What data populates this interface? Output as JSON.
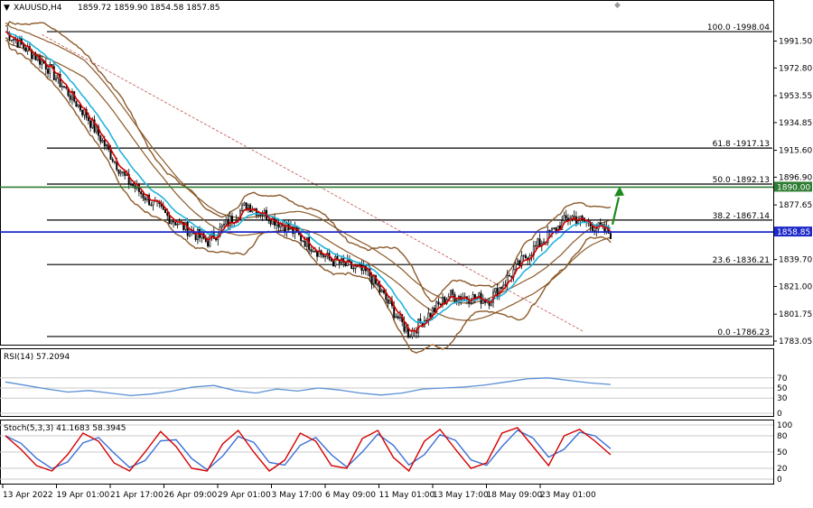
{
  "header": {
    "title": "XAUUSD,H4",
    "ohlc": "1859.72 1859.90 1854.58 1857.85"
  },
  "colors": {
    "candle": "#000000",
    "ema_fast": "#d40000",
    "ema_slow": "#22b3dd",
    "bands": "#8b5a2b",
    "fib": "#000000",
    "resistance": "#2e7d32",
    "price_line": "#1e2ac8",
    "trendline": "#c0504d",
    "arrow": "#1e8a1e",
    "rsi_line": "#5b8fd6",
    "stoch_main": "#d40000",
    "stoch_signal": "#3a6fd6"
  },
  "chart_data": [
    {
      "type": "candlestick",
      "symbol": "XAUUSD",
      "timeframe": "H4",
      "ylim": [
        1783.05,
        2010
      ],
      "y_ticks": [
        "1991.50",
        "1972.80",
        "1953.55",
        "1934.85",
        "1915.60",
        "1896.90",
        "1877.65",
        "1858.95",
        "1839.70",
        "1821.00",
        "1801.75",
        "1783.05"
      ],
      "x_ticks": [
        "13 Apr 2022",
        "19 Apr 01:00",
        "21 Apr 17:00",
        "26 Apr 09:00",
        "29 Apr 01:00",
        "3 May 17:00",
        "6 May 09:00",
        "11 May 01:00",
        "13 May 17:00",
        "18 May 09:00",
        "23 May 01:00"
      ],
      "key_prices": [
        1998,
        1975,
        1940,
        1895,
        1870,
        1852,
        1878,
        1862,
        1840,
        1830,
        1788,
        1815,
        1812,
        1845,
        1870,
        1857.85
      ],
      "fib_levels": [
        {
          "label": "100.0 -1998.04",
          "value": 1998.04
        },
        {
          "label": "61.8 -1917.13",
          "value": 1917.13
        },
        {
          "label": "50.0 -1892.13",
          "value": 1892.13
        },
        {
          "label": "38.2 -1867.14",
          "value": 1867.14
        },
        {
          "label": "23.6 -1836.21",
          "value": 1836.21
        },
        {
          "label": "0.0 -1786.23",
          "value": 1786.23
        }
      ],
      "resistance_label": "1890.00",
      "resistance_value": 1890.0,
      "current_price_label": "1858.85",
      "current_price_value": 1858.85
    },
    {
      "type": "line",
      "name": "RSI(14) 57.2094",
      "ylim": [
        0,
        100
      ],
      "levels": [
        "70",
        "50",
        "30",
        "0"
      ],
      "key_values": [
        62,
        55,
        48,
        42,
        45,
        40,
        35,
        38,
        44,
        52,
        55,
        45,
        40,
        48,
        44,
        50,
        46,
        40,
        36,
        40,
        48,
        50,
        52,
        56,
        62,
        68,
        70,
        65,
        60,
        57
      ]
    },
    {
      "type": "line",
      "name": "Stoch(5,3,3) 41.1683 58.3945",
      "ylim": [
        0,
        100
      ],
      "levels": [
        "100",
        "80",
        "50",
        "20",
        "0"
      ],
      "key_values": [
        80,
        55,
        25,
        15,
        45,
        85,
        70,
        30,
        15,
        50,
        88,
        60,
        20,
        15,
        65,
        90,
        50,
        15,
        35,
        85,
        70,
        25,
        20,
        75,
        90,
        40,
        15,
        70,
        92,
        55,
        20,
        30,
        85,
        95,
        60,
        25,
        80,
        92,
        70,
        45
      ]
    }
  ]
}
